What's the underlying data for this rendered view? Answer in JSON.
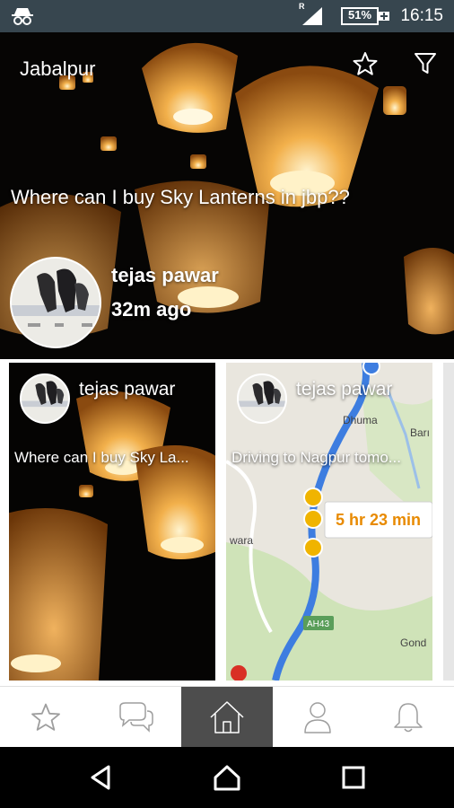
{
  "status_bar": {
    "time": "16:15",
    "battery": "51%",
    "network_label": "R",
    "icons": [
      "incognito-icon",
      "signal-icon",
      "battery-icon"
    ]
  },
  "hero": {
    "city": "Jabalpur",
    "question": "Where can I buy Sky Lanterns in jbp??",
    "author": "tejas pawar",
    "time_ago": "32m ago",
    "icons": [
      "star-icon",
      "filter-icon"
    ]
  },
  "cards": [
    {
      "author": "tejas pawar",
      "text": "Where can I buy Sky La..."
    },
    {
      "author": "tejas pawar",
      "text": "Driving to Nagpur tomo...",
      "map": {
        "place_1": "Dhuma",
        "place_2": "Barı",
        "place_3": "wara",
        "place_4": "Gond",
        "road": "AH43",
        "duration": "5 hr 23 min"
      }
    }
  ],
  "bottom_nav": {
    "items": [
      "favorites",
      "chat",
      "home",
      "profile",
      "notifications"
    ],
    "active": "home"
  },
  "system_nav": {
    "items": [
      "back",
      "home",
      "recents"
    ]
  },
  "colors": {
    "status_bar": "#37464f",
    "nav_active": "#4d4d4d",
    "lantern": "#f0a542",
    "route": "#3d7de0",
    "duration": "#e88a00"
  }
}
